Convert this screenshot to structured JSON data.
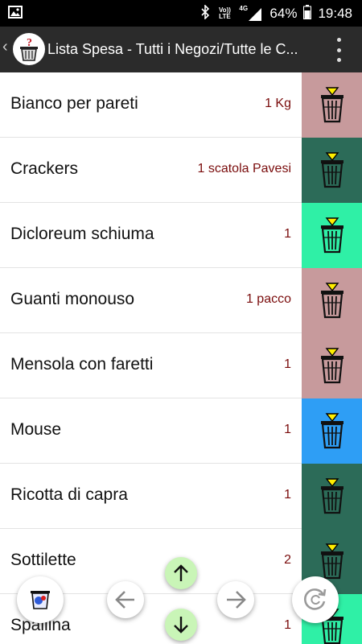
{
  "status_bar": {
    "battery": "64%",
    "time": "19:48",
    "network": "4G",
    "volte": "Vo)) LTE"
  },
  "app_bar": {
    "back_glyph": "‹",
    "title": "Lista Spesa - Tutti i Negozi/Tutte le C..."
  },
  "items": [
    {
      "name": "Bianco per pareti",
      "qty": "1 Kg",
      "color": "#c79a9c"
    },
    {
      "name": "Crackers",
      "qty": "1 scatola Pavesi",
      "color": "#2c6b58"
    },
    {
      "name": "Dicloreum schiuma",
      "qty": "1",
      "color": "#2ff0a6"
    },
    {
      "name": "Guanti monouso",
      "qty": "1 pacco",
      "color": "#c79a9c"
    },
    {
      "name": "Mensola con faretti",
      "qty": "1",
      "color": "#c79a9c"
    },
    {
      "name": "Mouse",
      "qty": "1",
      "color": "#2e9ef5"
    },
    {
      "name": "Ricotta di capra",
      "qty": "1",
      "color": "#2c6b58"
    },
    {
      "name": "Sottilette",
      "qty": "2",
      "color": "#2c6b58"
    },
    {
      "name": "Spallina",
      "qty": "1",
      "color": "#2ff0a6"
    }
  ],
  "controls": {
    "icons": [
      "cart-icon",
      "arrow-left-icon",
      "arrow-up-icon",
      "arrow-down-icon",
      "arrow-right-icon",
      "refresh-icon"
    ]
  }
}
